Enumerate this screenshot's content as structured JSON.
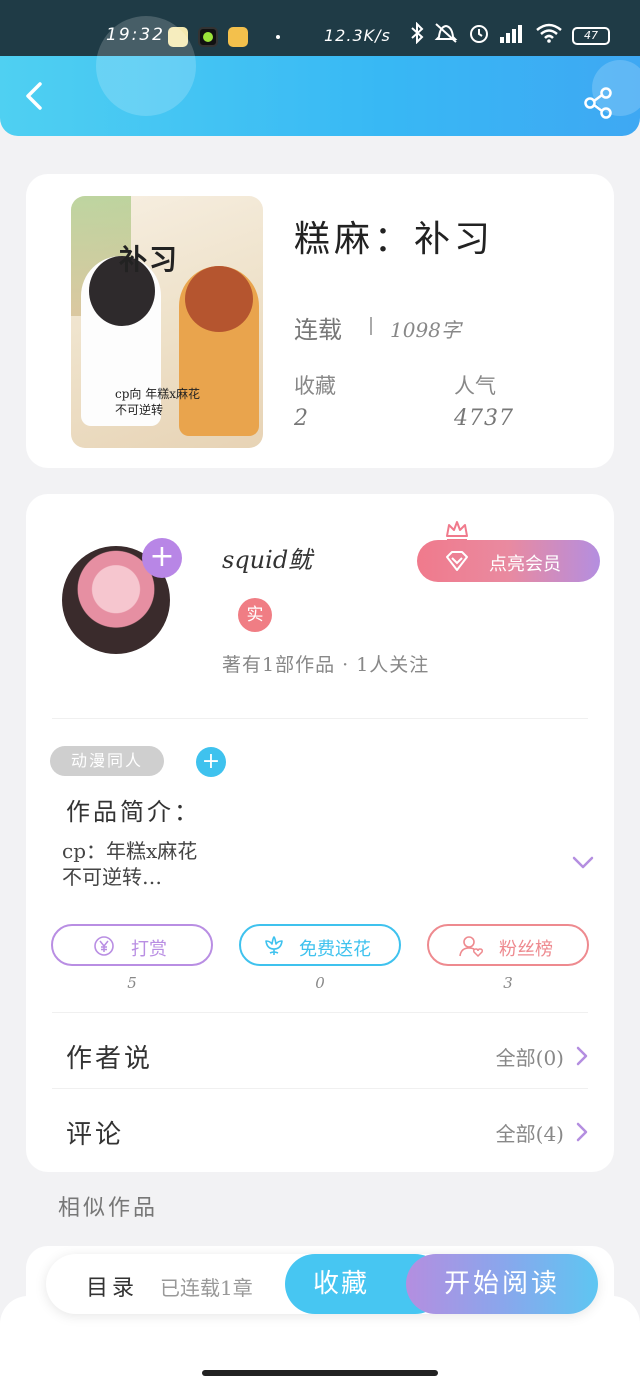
{
  "status_bar": {
    "time": "19:32",
    "net_speed": "12.3K/s",
    "battery": "47"
  },
  "book": {
    "title": "糕麻：补习",
    "status": "连载",
    "word_count": "1098字",
    "favorites_label": "收藏",
    "favorites_value": "2",
    "popularity_label": "人气",
    "popularity_value": "4737",
    "cover": {
      "title": "补习",
      "subtitle_line1": "cp向 年糕x麻花",
      "subtitle_line2": "不可逆转"
    }
  },
  "author": {
    "name": "squid鱿",
    "real_badge": "实",
    "meta": "著有1部作品 · 1人关注",
    "vip_button": "点亮会员"
  },
  "work": {
    "tag": "动漫同人",
    "intro_title": "作品简介：",
    "intro_line1": "cp：年糕x麻花",
    "intro_line2": "不可逆转…"
  },
  "actions": [
    {
      "label": "打赏",
      "count": "5",
      "color": "#b98ee3",
      "icon": "yen-icon"
    },
    {
      "label": "免费送花",
      "count": "0",
      "color": "#3fc2ee",
      "icon": "flower-icon"
    },
    {
      "label": "粉丝榜",
      "count": "3",
      "color": "#ee8a8f",
      "icon": "fans-icon"
    }
  ],
  "rows": {
    "author_says": {
      "title": "作者说",
      "right": "全部(0)"
    },
    "comments": {
      "title": "评论",
      "right": "全部(4)"
    }
  },
  "similar_title": "相似作品",
  "bottom_bar": {
    "toc": "目录",
    "updated": "已连载1章",
    "collect": "收藏",
    "read": "开始阅读"
  },
  "colors": {
    "header_gradient_start": "#4fd0f2",
    "header_gradient_end": "#3ea8f3",
    "vip_pink": "#f07a8c",
    "accent_purple": "#b48ee0",
    "accent_blue": "#47c6f2"
  }
}
